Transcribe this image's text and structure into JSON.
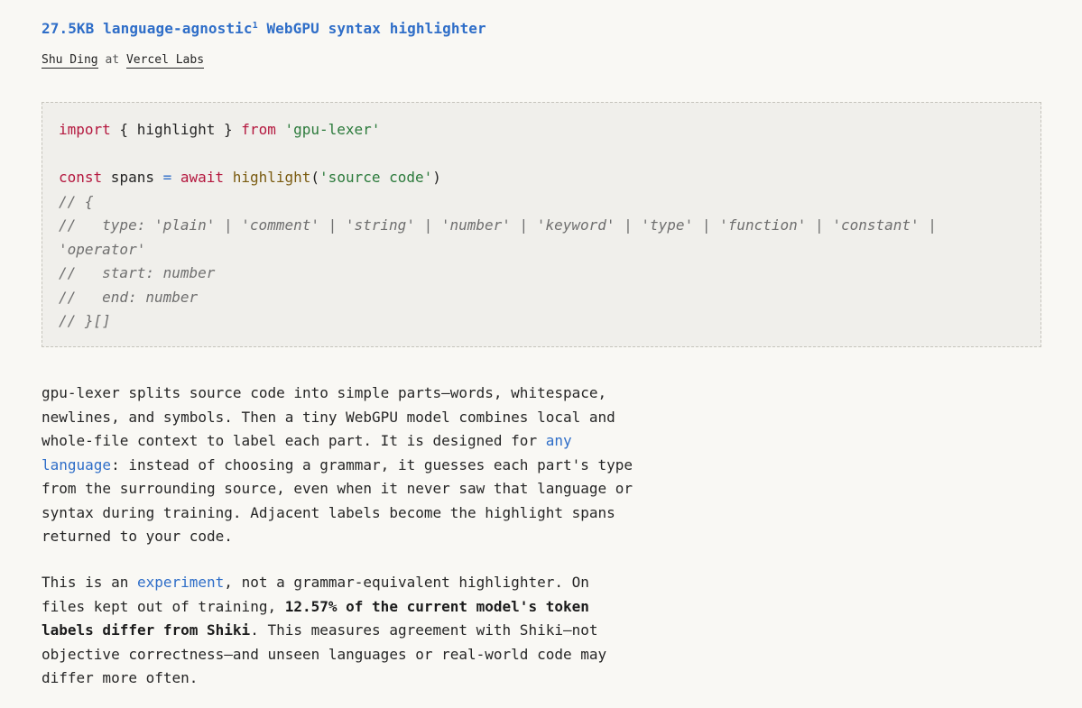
{
  "header": {
    "title": "27.5KB language-agnostic",
    "title_sup": "1",
    "title_suffix": " WebGPU syntax highlighter",
    "author": "Shu Ding",
    "at": " at ",
    "org": "Vercel Labs"
  },
  "code": {
    "line1": {
      "kw1": "import",
      "t1": " { highlight } ",
      "kw2": "from",
      "sp": " ",
      "str": "'gpu-lexer'"
    },
    "line3": {
      "kw1": "const",
      "t1": " spans ",
      "op": "=",
      "sp": " ",
      "kw2": "await",
      "sp2": " ",
      "fn": "highlight",
      "p1": "(",
      "str": "'source code'",
      "p2": ")"
    },
    "comments": [
      "// {",
      "//   type: 'plain' | 'comment' | 'string' | 'number' | 'keyword' | 'type' | 'function' | 'constant' |",
      "'operator'",
      "//   start: number",
      "//   end: number",
      "// }[]"
    ]
  },
  "paragraph1": {
    "l1": "gpu-lexer splits source code into simple parts—words, whitespace,",
    "l2": "newlines, and symbols. Then a tiny WebGPU model combines local and",
    "l3a": "whole-file context to label each part. It is designed for ",
    "link1": "any",
    "link2": "language",
    "l4b": ": instead of choosing a grammar, it guesses each part's type",
    "l5": "from the surrounding source, even when it never saw that language or",
    "l6": "syntax during training. Adjacent labels become the highlight spans",
    "l7": "returned to your code."
  },
  "paragraph2": {
    "l1a": "This is an ",
    "link": "experiment",
    "l1b": ", not a grammar-equivalent highlighter. On",
    "l2a": "files kept out of training, ",
    "bold1": "12.57% of the current model's token",
    "bold2": "labels differ from Shiki",
    "l3b": ". This measures agreement with Shiki—not",
    "l4": "objective correctness—and unseen languages or real-world code may",
    "l5": "differ more often."
  },
  "colors": {
    "background": "#f9f8f4",
    "accent": "#2f6ec8",
    "keyword": "#b4173e",
    "string": "#2b7a3b",
    "comment": "#6f6f6f",
    "code_bg": "#f0efeb"
  }
}
